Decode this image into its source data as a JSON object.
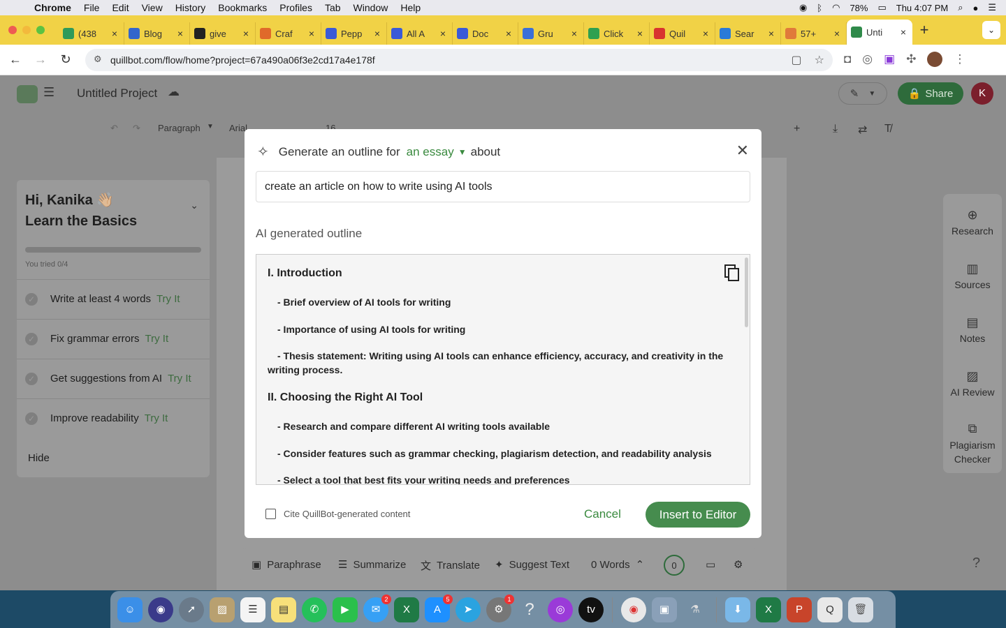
{
  "menubar": {
    "app": "Chrome",
    "items": [
      "File",
      "Edit",
      "View",
      "History",
      "Bookmarks",
      "Profiles",
      "Tab",
      "Window",
      "Help"
    ],
    "battery": "78%",
    "clock": "Thu 4:07 PM"
  },
  "tabs": [
    {
      "label": "(438",
      "color": "#2f9a5a"
    },
    {
      "label": "Blog",
      "color": "#3366cc"
    },
    {
      "label": "give",
      "color": "#222222"
    },
    {
      "label": "Craf",
      "color": "#e06a2a"
    },
    {
      "label": "Pepp",
      "color": "#3a5ad8"
    },
    {
      "label": "All A",
      "color": "#3a5ad8"
    },
    {
      "label": "Doc",
      "color": "#3a5ad8"
    },
    {
      "label": "Gru",
      "color": "#3a6fd8"
    },
    {
      "label": "Click",
      "color": "#2fa050"
    },
    {
      "label": "Quil",
      "color": "#d8332f"
    },
    {
      "label": "Sear",
      "color": "#2a7ad8"
    },
    {
      "label": "57+",
      "color": "#e07a3a"
    },
    {
      "label": "Unti",
      "color": "#2f8a4a",
      "active": true
    }
  ],
  "url": "quillbot.com/flow/home?project=67a490a06f3e2cd17a4e178f",
  "app": {
    "project_title": "Untitled Project",
    "share_label": "Share",
    "avatar_letter": "K"
  },
  "toolbar": {
    "paragraph": "Paragraph",
    "font": "Arial",
    "size": "16"
  },
  "sidebar": {
    "greeting": "Hi, Kanika 👋🏼",
    "subtitle": "Learn the Basics",
    "progress_text": "You tried 0/4",
    "progress": 0,
    "tasks": [
      {
        "label": "Write at least 4 words",
        "action": "Try It"
      },
      {
        "label": "Fix grammar errors",
        "action": "Try It"
      },
      {
        "label": "Get suggestions from AI",
        "action": "Try It"
      },
      {
        "label": "Improve readability",
        "action": "Try It"
      }
    ],
    "hide_label": "Hide"
  },
  "right_panel": [
    {
      "label": "Research",
      "icon": "globe-icon"
    },
    {
      "label": "Sources",
      "icon": "books-icon"
    },
    {
      "label": "Notes",
      "icon": "notes-icon"
    },
    {
      "label": "AI Review",
      "icon": "ai-review-icon"
    },
    {
      "label": "Plagiarism Checker",
      "icon": "plagiarism-icon"
    }
  ],
  "bottom_bar": {
    "paraphrase": "Paraphrase",
    "summarize": "Summarize",
    "translate": "Translate",
    "suggest": "Suggest Text",
    "words": "0 Words",
    "score": "0"
  },
  "modal": {
    "title_prefix": "Generate an outline for",
    "doc_type": "an essay",
    "title_suffix": "about",
    "topic_value": "create an article on how to write using AI tools",
    "outline_label": "AI generated outline",
    "outline": {
      "h1": "I. Introduction",
      "h1_items": [
        "- Brief overview of AI tools for writing",
        "- Importance of using AI tools for writing",
        "- Thesis statement: Writing using AI tools can enhance efficiency, accuracy, and creativity in the writing process."
      ],
      "h2": "II. Choosing the Right AI Tool",
      "h2_items": [
        "- Research and compare different AI writing tools available",
        "- Consider features such as grammar checking, plagiarism detection, and readability analysis",
        "- Select a tool that best fits your writing needs and preferences"
      ]
    },
    "cite_label": "Cite QuillBot-generated content",
    "cancel_label": "Cancel",
    "insert_label": "Insert to Editor"
  },
  "dock_badges": {
    "messages": "2",
    "appstore": "5",
    "settings": "1"
  },
  "colors": {
    "brand_green": "#468c4e",
    "accent_green": "#3a8a3f",
    "tabbar": "#f1d246"
  }
}
